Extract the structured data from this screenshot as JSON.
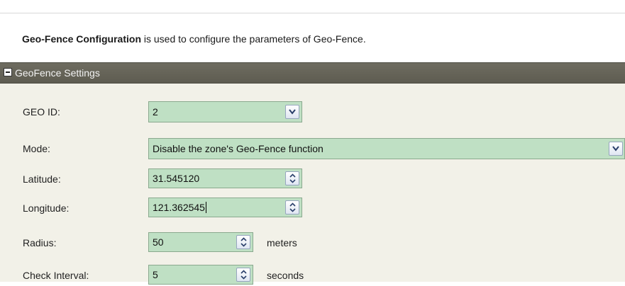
{
  "intro": {
    "title": "Geo-Fence Configuration",
    "text": " is used to configure the parameters of Geo-Fence."
  },
  "panel": {
    "title": "GeoFence Settings",
    "icon": "collapse-minus-icon"
  },
  "fields": {
    "geo_id": {
      "label": "GEO ID:",
      "value": "2"
    },
    "mode": {
      "label": "Mode:",
      "value": "Disable the zone's Geo-Fence function"
    },
    "latitude": {
      "label": "Latitude:",
      "value": "31.545120"
    },
    "longitude": {
      "label": "Longitude:",
      "value": "121.362545"
    },
    "radius": {
      "label": "Radius:",
      "value": "50",
      "unit": "meters"
    },
    "check_interval": {
      "label": "Check Interval:",
      "value": "5",
      "unit": "seconds"
    }
  },
  "colors": {
    "header_bg": "#605e53",
    "panel_bg": "#f2f1e8",
    "field_bg": "#bfe0c4"
  }
}
